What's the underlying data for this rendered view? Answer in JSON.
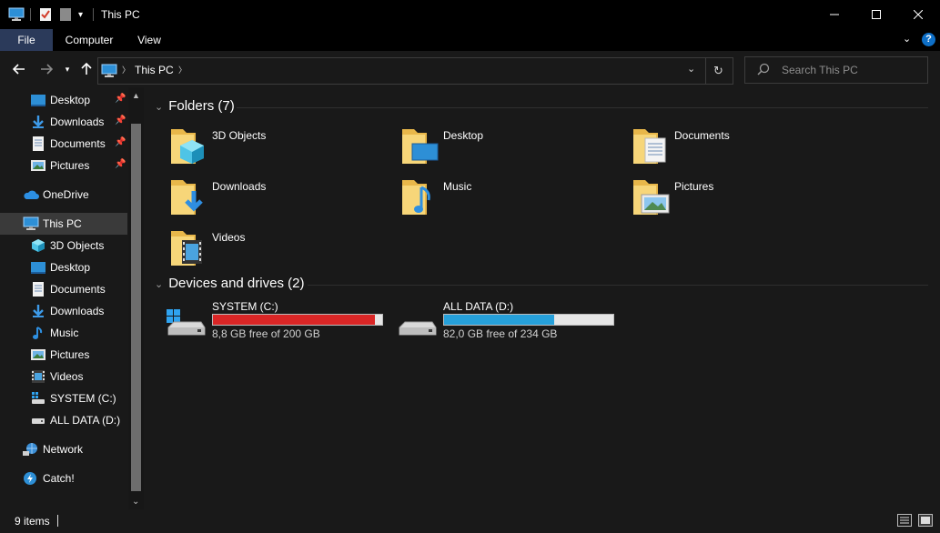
{
  "window": {
    "title": "This PC",
    "accent_color": "#0078d7"
  },
  "ribbon": {
    "tabs": [
      "File",
      "Computer",
      "View"
    ]
  },
  "address_bar": {
    "location": "This PC",
    "search_placeholder": "Search This PC"
  },
  "nav_pane": {
    "items": [
      {
        "label": "Desktop",
        "icon": "desktop-icon",
        "pinned": true
      },
      {
        "label": "Downloads",
        "icon": "download-arrow-icon",
        "pinned": true
      },
      {
        "label": "Documents",
        "icon": "document-icon",
        "pinned": true
      },
      {
        "label": "Pictures",
        "icon": "picture-icon",
        "pinned": true
      },
      {
        "label": "OneDrive",
        "icon": "cloud-icon",
        "pinned": false
      },
      {
        "label": "This PC",
        "icon": "computer-icon",
        "pinned": false,
        "selected": true
      },
      {
        "label": "3D Objects",
        "icon": "cube-icon",
        "pinned": false
      },
      {
        "label": "Desktop",
        "icon": "desktop-icon",
        "pinned": false
      },
      {
        "label": "Documents",
        "icon": "document-icon",
        "pinned": false
      },
      {
        "label": "Downloads",
        "icon": "download-arrow-icon",
        "pinned": false
      },
      {
        "label": "Music",
        "icon": "music-note-icon",
        "pinned": false
      },
      {
        "label": "Pictures",
        "icon": "picture-icon",
        "pinned": false
      },
      {
        "label": "Videos",
        "icon": "film-icon",
        "pinned": false
      },
      {
        "label": "SYSTEM (C:)",
        "icon": "system-drive-icon",
        "pinned": false
      },
      {
        "label": "ALL DATA (D:)",
        "icon": "drive-icon",
        "pinned": false
      },
      {
        "label": "Network",
        "icon": "network-icon",
        "pinned": false
      },
      {
        "label": "Catch!",
        "icon": "catch-icon",
        "pinned": false
      }
    ]
  },
  "content": {
    "folders_header": "Folders (7)",
    "folders": [
      {
        "label": "3D Objects",
        "icon": "folder-3d-objects-icon"
      },
      {
        "label": "Desktop",
        "icon": "folder-desktop-icon"
      },
      {
        "label": "Documents",
        "icon": "folder-documents-icon"
      },
      {
        "label": "Downloads",
        "icon": "folder-downloads-icon"
      },
      {
        "label": "Music",
        "icon": "folder-music-icon"
      },
      {
        "label": "Pictures",
        "icon": "folder-pictures-icon"
      },
      {
        "label": "Videos",
        "icon": "folder-videos-icon"
      }
    ],
    "drives_header": "Devices and drives (2)",
    "drives": [
      {
        "label": "SYSTEM (C:)",
        "free_text": "8,8 GB free of 200 GB",
        "used_fraction": 0.956,
        "bar_color": "#da2626",
        "icon": "system-drive-icon"
      },
      {
        "label": "ALL DATA (D:)",
        "free_text": "82,0 GB free of 234 GB",
        "used_fraction": 0.65,
        "bar_color": "#26a0da",
        "icon": "drive-icon"
      }
    ]
  },
  "status_bar": {
    "items_count": "9 items"
  }
}
